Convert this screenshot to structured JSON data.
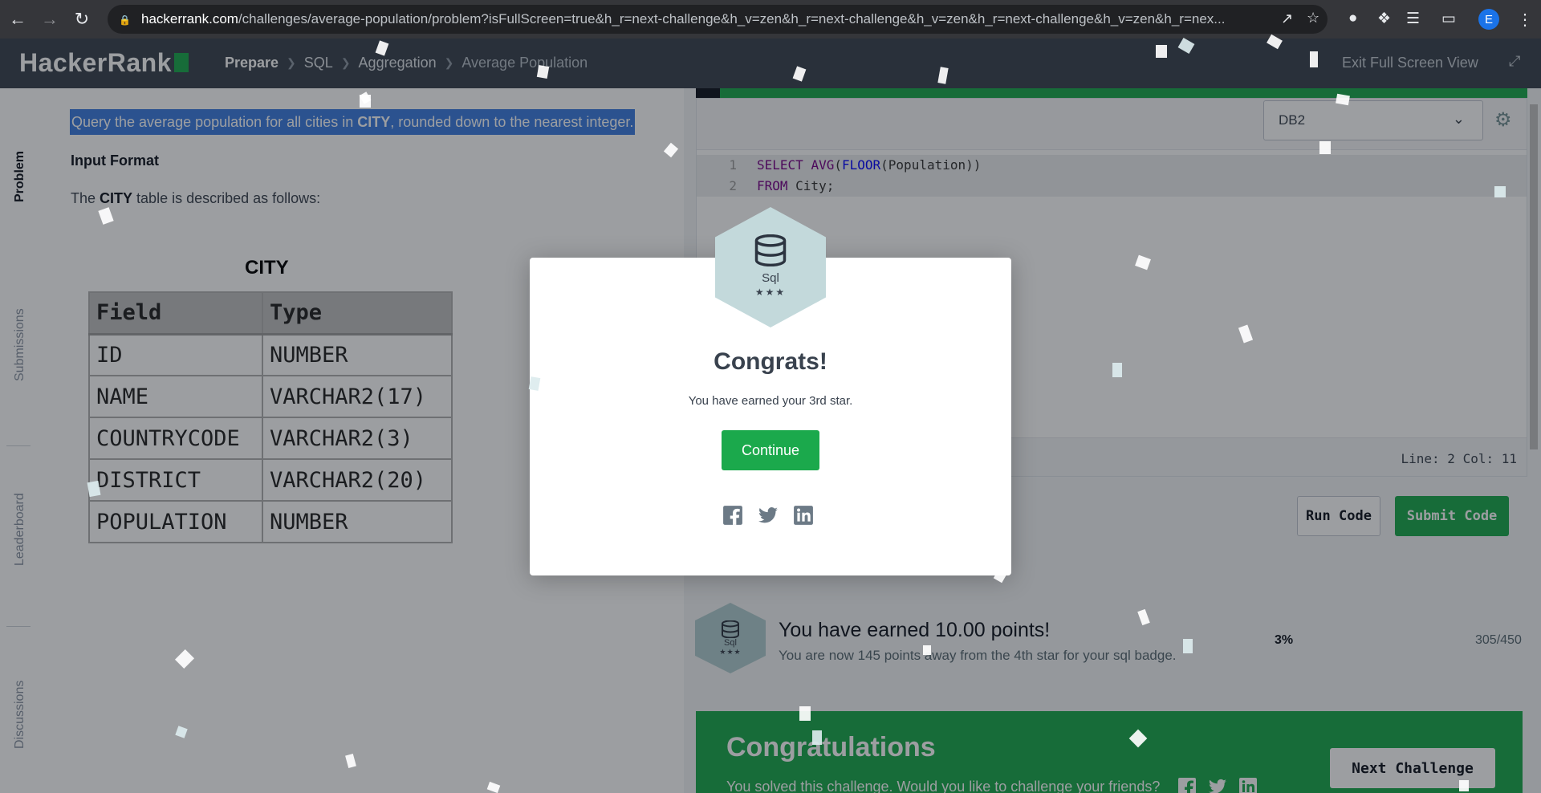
{
  "browser": {
    "url_host": "hackerrank.com",
    "url_path": "/challenges/average-population/problem?isFullScreen=true&h_r=next-challenge&h_v=zen&h_r=next-challenge&h_v=zen&h_r=next-challenge&h_v=zen&h_r=nex...",
    "profile_initial": "E"
  },
  "header": {
    "logo": "HackerRank",
    "breadcrumb": [
      "Prepare",
      "SQL",
      "Aggregation",
      "Average Population"
    ],
    "exit_fullscreen": "Exit Full Screen View"
  },
  "side_tabs": [
    "Problem",
    "Submissions",
    "Leaderboard",
    "Discussions"
  ],
  "problem": {
    "statement_pre": "Query the average population for all cities in ",
    "statement_bold": "CITY",
    "statement_post": ", rounded down to the nearest integer.",
    "input_format_heading": "Input Format",
    "desc_pre": "The ",
    "desc_bold": "CITY",
    "desc_post": " table is described as follows:",
    "table_caption": "CITY",
    "table_headers": [
      "Field",
      "Type"
    ],
    "table_rows": [
      [
        "ID",
        "NUMBER"
      ],
      [
        "NAME",
        "VARCHAR2(17)"
      ],
      [
        "COUNTRYCODE",
        "VARCHAR2(3)"
      ],
      [
        "DISTRICT",
        "VARCHAR2(20)"
      ],
      [
        "POPULATION",
        "NUMBER"
      ]
    ]
  },
  "editor": {
    "language": "DB2",
    "line_numbers": [
      "1",
      "2"
    ],
    "line_col": "Line: 2 Col: 11",
    "run_label": "Run Code",
    "submit_label": "Submit Code"
  },
  "progress": {
    "title": "You have earned 10.00 points!",
    "subtitle": "You are now 145 points away from the 4th star for your sql badge.",
    "percent": "3%",
    "count": "305/450",
    "badge_name": "Sql",
    "badge_stars": "★★★"
  },
  "banner": {
    "title": "Congratulations",
    "subtitle": "You solved this challenge. Would you like to challenge your friends?",
    "next_label": "Next Challenge"
  },
  "modal": {
    "badge_name": "Sql",
    "badge_stars": "★★★",
    "title": "Congrats!",
    "subtitle": "You have earned your 3rd star.",
    "continue_label": "Continue"
  },
  "icons": {
    "back": "arrow-left-icon",
    "forward": "arrow-right-icon",
    "reload": "reload-icon",
    "lock": "lock-icon",
    "share": "share-icon",
    "bookmark": "star-icon",
    "gear": "gear-icon",
    "facebook": "facebook-icon",
    "twitter": "twitter-icon",
    "linkedin": "linkedin-icon"
  },
  "colors": {
    "brand_green": "#1ba94c",
    "header_bg": "#39424e",
    "highlight": "#3d7de0"
  }
}
